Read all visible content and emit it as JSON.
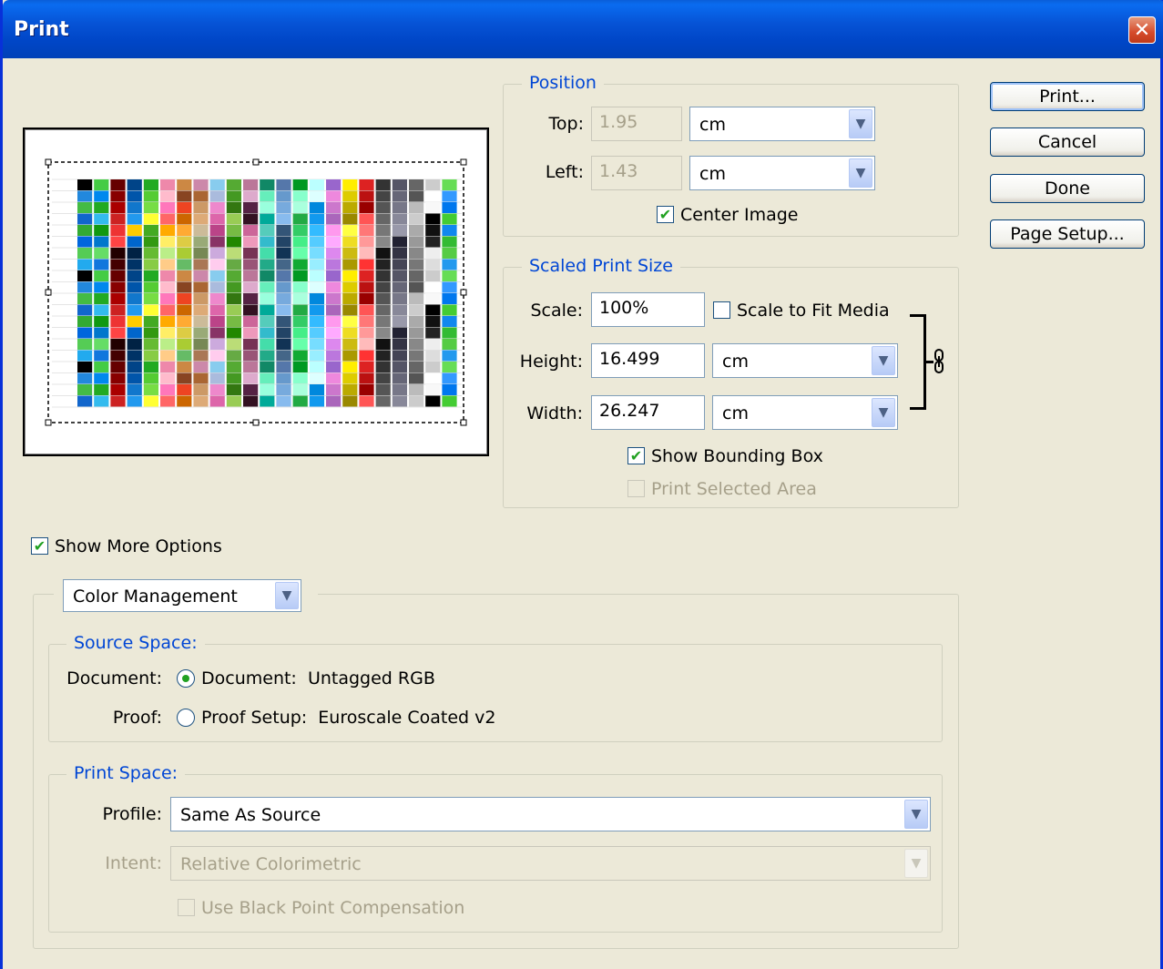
{
  "window": {
    "title": "Print",
    "close_glyph": "✕"
  },
  "buttons": {
    "print": "Print...",
    "cancel": "Cancel",
    "done": "Done",
    "page_setup": "Page Setup..."
  },
  "position": {
    "legend": "Position",
    "top_label": "Top:",
    "top_value": "1.95",
    "top_unit": "cm",
    "left_label": "Left:",
    "left_value": "1.43",
    "left_unit": "cm",
    "center_image": {
      "label": "Center Image",
      "checked": true
    }
  },
  "scaled": {
    "legend": "Scaled Print Size",
    "scale_label": "Scale:",
    "scale_value": "100%",
    "scale_to_fit": {
      "label": "Scale to Fit Media",
      "checked": false
    },
    "height_label": "Height:",
    "height_value": "16.499",
    "height_unit": "cm",
    "width_label": "Width:",
    "width_value": "26.247",
    "width_unit": "cm",
    "show_bounding_box": {
      "label": "Show Bounding Box",
      "checked": true
    },
    "print_selected_area": {
      "label": "Print Selected Area",
      "checked": false,
      "disabled": true
    }
  },
  "more_options": {
    "label": "Show More Options",
    "checked": true
  },
  "section_select": {
    "value": "Color Management"
  },
  "source_space": {
    "legend": "Source Space:",
    "document_label": "Document:",
    "document_option": "Document:",
    "document_value": "Untagged RGB",
    "proof_label": "Proof:",
    "proof_option": "Proof Setup:",
    "proof_value": "Euroscale Coated v2",
    "selected": "document"
  },
  "print_space": {
    "legend": "Print Space:",
    "profile_label": "Profile:",
    "profile_value": "Same As Source",
    "intent_label": "Intent:",
    "intent_value": "Relative Colorimetric",
    "black_point": {
      "label": "Use Black Point Compensation",
      "checked": false,
      "disabled": true
    }
  },
  "icons": {
    "check": "✔",
    "arrow": "▼",
    "link": "chain-link-icon"
  }
}
